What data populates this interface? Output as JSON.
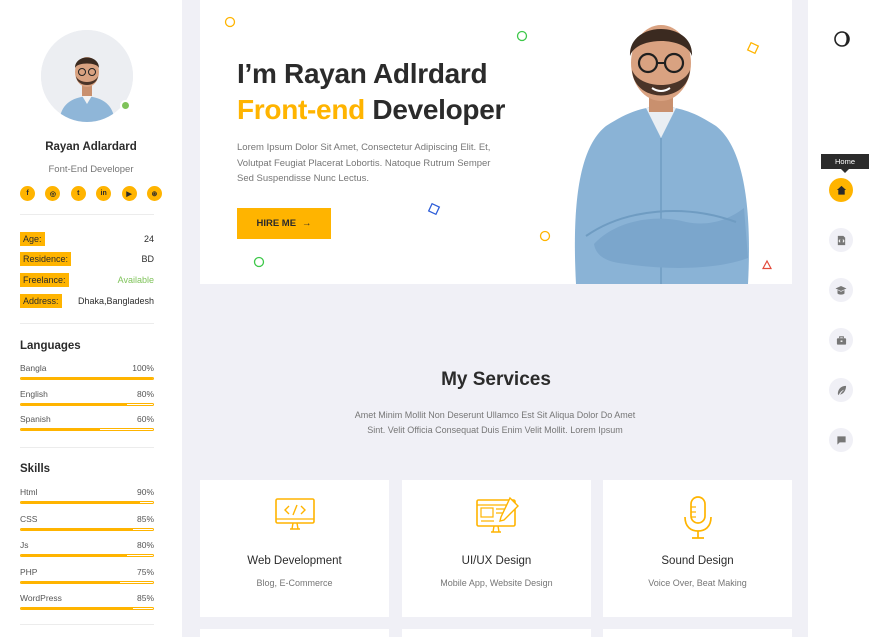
{
  "profile": {
    "name": "Rayan Adlardard",
    "role": "Font-End Developer",
    "socials": [
      "facebook-icon",
      "instagram-icon",
      "twitter-icon",
      "linkedin-icon",
      "youtube-icon",
      "dribbble-icon"
    ],
    "social_glyphs": [
      "f",
      "◎",
      "t",
      "in",
      "▶",
      "⊛"
    ]
  },
  "info": [
    {
      "label": "Age:",
      "value": "24",
      "accent": false
    },
    {
      "label": "Residence:",
      "value": "BD",
      "accent": false
    },
    {
      "label": "Freelance:",
      "value": "Available",
      "accent": true
    },
    {
      "label": "Address:",
      "value": "Dhaka,Bangladesh",
      "accent": false
    }
  ],
  "languages": {
    "title": "Languages",
    "items": [
      {
        "name": "Bangla",
        "percent_label": "100%",
        "level": 1.0
      },
      {
        "name": "English",
        "percent_label": "80%",
        "level": 0.8
      },
      {
        "name": "Spanish",
        "percent_label": "60%",
        "level": 0.6
      }
    ]
  },
  "skills": {
    "title": "Skills",
    "items": [
      {
        "name": "Html",
        "percent_label": "90%",
        "level": 0.9
      },
      {
        "name": "CSS",
        "percent_label": "85%",
        "level": 0.85
      },
      {
        "name": "Js",
        "percent_label": "80%",
        "level": 0.8
      },
      {
        "name": "PHP",
        "percent_label": "75%",
        "level": 0.75
      },
      {
        "name": "WordPress",
        "percent_label": "85%",
        "level": 0.85
      }
    ]
  },
  "hero": {
    "title_line1": "I’m Rayan Adlrdard",
    "title_accent": "Front-end",
    "title_rest": " Developer",
    "description": "Lorem Ipsum Dolor Sit Amet, Consectetur Adipiscing Elit. Et, Volutpat Feugiat Placerat Lobortis. Natoque Rutrum Semper Sed Suspendisse Nunc Lectus.",
    "button_label": "HIRE ME",
    "button_arrow": "→"
  },
  "services": {
    "title": "My Services",
    "description": "Amet Minim Mollit Non Deserunt Ullamco Est Sit Aliqua Dolor Do Amet Sint. Velit Officia Consequat Duis Enim Velit Mollit. Lorem Ipsum",
    "cards": [
      {
        "title": "Web Development",
        "subtitle": "Blog, E-Commerce",
        "icon": "code-monitor-icon"
      },
      {
        "title": "UI/UX Design",
        "subtitle": "Mobile App, Website Design",
        "icon": "design-monitor-icon"
      },
      {
        "title": "Sound Design",
        "subtitle": "Voice Over, Beat Making",
        "icon": "microphone-icon"
      }
    ]
  },
  "nav": {
    "tooltip": "Home",
    "items": [
      "home-icon",
      "code-icon",
      "education-icon",
      "briefcase-icon",
      "feather-icon",
      "chat-icon"
    ],
    "active": "home-icon"
  },
  "colors": {
    "accent": "#ffb400",
    "available": "#7fc35a",
    "background": "#f0f0f6"
  }
}
